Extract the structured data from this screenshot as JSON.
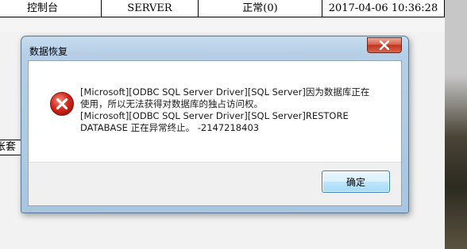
{
  "background_table": {
    "row": [
      "控制台",
      "SERVER",
      "正常(0)",
      "2017-04-06 10:36:28"
    ],
    "side_label": "帐套"
  },
  "dialog": {
    "title": "数据恢复",
    "message": "[Microsoft][ODBC SQL Server Driver][SQL Server]因为数据库正在\n使用，所以无法获得对数据库的独占访问权。\n[Microsoft][ODBC SQL Server Driver][SQL Server]RESTORE\nDATABASE 正在异常终止。 -2147218403",
    "ok_label": "确定",
    "icon": "error-icon",
    "close_icon": "close-icon"
  },
  "colors": {
    "error_red": "#d42a1e",
    "close_button_red": "#c0341f",
    "window_frame": "#b6cfe6"
  }
}
